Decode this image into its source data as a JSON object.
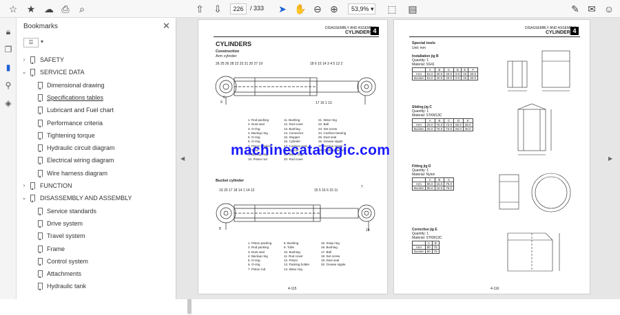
{
  "toolbar": {
    "page_current": "226",
    "page_total": "/ 333",
    "zoom": "53,9%"
  },
  "bookmarks_panel": {
    "title": "Bookmarks",
    "items": [
      {
        "label": "SAFETY",
        "level": 0,
        "state": "collapsed"
      },
      {
        "label": "SERVICE DATA",
        "level": 0,
        "state": "expanded"
      },
      {
        "label": "Dimensional drawing",
        "level": 1
      },
      {
        "label": "Specifications tables",
        "level": 1
      },
      {
        "label": "Lubricant and Fuel chart",
        "level": 1
      },
      {
        "label": "Performance criteria",
        "level": 1
      },
      {
        "label": "Tightening torque",
        "level": 1
      },
      {
        "label": "Hydraulic circuit diagram",
        "level": 1
      },
      {
        "label": "Electrical wiring diagram",
        "level": 1
      },
      {
        "label": "Wire harness diagram",
        "level": 1
      },
      {
        "label": "FUNCTION",
        "level": 0,
        "state": "collapsed"
      },
      {
        "label": "DISASSEMBLY AND ASSEMBLY",
        "level": 0,
        "state": "expanded"
      },
      {
        "label": "Service standards",
        "level": 1
      },
      {
        "label": "Drive system",
        "level": 1
      },
      {
        "label": "Travel system",
        "level": 1
      },
      {
        "label": "Frame",
        "level": 1
      },
      {
        "label": "Control system",
        "level": 1
      },
      {
        "label": "Attachments",
        "level": 1
      },
      {
        "label": "Hydraulic tank",
        "level": 1
      }
    ]
  },
  "watermark": "machinecatalogic.com",
  "left_page": {
    "header_small": "DISASSEMBLY AND ASSEMBLY",
    "header_bold": "CYLINDERS",
    "chapter": "4",
    "title": "CYLINDERS",
    "construction": "Construction",
    "arm_cylinder": "Arm cylinder",
    "bucket_cylinder": "Bucket cylinder",
    "page_number": "4-115",
    "arm_top_labels": "26  25  26 28 22  23  21 20 27  19",
    "arm_top_labels_right": "18  6  15 14 3  4  5 12 2",
    "arm_bottom_labels": "17  16  1  13",
    "bucket_top_left": "19  20    17 18 14  1  14 12",
    "bucket_top_right": "15  5  16  6 15 11",
    "arm_legend_col1": [
      "1. Rod packing",
      "2. Dust seal",
      "3. O-ring",
      "4. Backup ring",
      "5. O-ring",
      "6. O-ring",
      "7. Piston packing",
      "8. Tube",
      "9. Backup ring",
      "10. Piston rod"
    ],
    "arm_legend_col2": [
      "11. Bushing",
      "12. Rod cover",
      "13. Bushing",
      "14. Connector",
      "15. Stopper",
      "16. Cylinder",
      "17. Cushion seal",
      "18. Spacer",
      "19. Wear ring",
      "20. Rod cover"
    ],
    "arm_legend_col3": [
      "21. Wear ring",
      "22. Ball",
      "23. Set screw",
      "24. Cushion bearing",
      "25. Dust seal",
      "26. Grease nipple",
      "27. Grease nipple",
      "28. Cushion bearing"
    ],
    "bucket_legend_col1": [
      "1. Piston packing",
      "2. Rod packing",
      "3. Dust seal",
      "4. Backup ring",
      "5. O-ring",
      "6. O-ring",
      "7. Piston rod"
    ],
    "bucket_legend_col2": [
      "8. Bushing",
      "9. Tube",
      "10. Bushing",
      "11. Rod cover",
      "12. Piston",
      "13. Packing holder",
      "14. Wear ring"
    ],
    "bucket_legend_col3": [
      "15. Snap ring",
      "16. Bushing",
      "17. Ball",
      "18. Set screw",
      "19. Dust seal",
      "20. Grease nipple"
    ]
  },
  "right_page": {
    "header_small": "DISASSEMBLY AND ASSEMBLY",
    "header_bold": "CYLINDERS",
    "chapter": "4",
    "special_tools": "Special tools",
    "unit": "Unit: mm",
    "page_number": "4-116",
    "jig_b": {
      "title": "Installation jig B",
      "qty": "Quantity: 1",
      "mat": "Material: SS41",
      "header": [
        "",
        "A",
        "B",
        "C",
        "D",
        "E",
        "F"
      ],
      "rows": [
        [
          "Arm",
          "54.0",
          "40.0",
          "40.0",
          "9.0",
          "15",
          "60.0"
        ],
        [
          "Bucket",
          "54.0",
          "40.0",
          "40.0",
          "9.0",
          "15",
          "60.0"
        ]
      ]
    },
    "jig_c": {
      "title": "Sliding jig C",
      "qty": "Quantity: 1",
      "mat": "Material: STKM13C",
      "header": [
        "",
        "A",
        "B",
        "C",
        "D",
        "E"
      ],
      "rows": [
        [
          "Arm",
          "25.0",
          "75.0",
          "73.0",
          "60.0",
          "36.0"
        ],
        [
          "Bucket",
          "25.0",
          "75.0",
          "73.0",
          "60.0",
          "36.0"
        ]
      ]
    },
    "jig_d": {
      "title": "Fitting jig D",
      "qty": "Quantity: 1",
      "mat": "Material: Nylon",
      "header": [
        "",
        "A",
        "B",
        "C"
      ],
      "rows": [
        [
          "Arm",
          "96.0",
          "16.0",
          "75.0"
        ],
        [
          "Bucket",
          "96.0",
          "16.0",
          "75.0"
        ]
      ]
    },
    "jig_e": {
      "title": "Corrective jig E",
      "qty": "Quantity: 1",
      "mat": "Material: STKM13C",
      "header": [
        "",
        "A",
        "B"
      ],
      "rows": [
        [
          "Arm",
          "90",
          "75"
        ],
        [
          "Bucket",
          "90",
          "75"
        ]
      ]
    }
  }
}
